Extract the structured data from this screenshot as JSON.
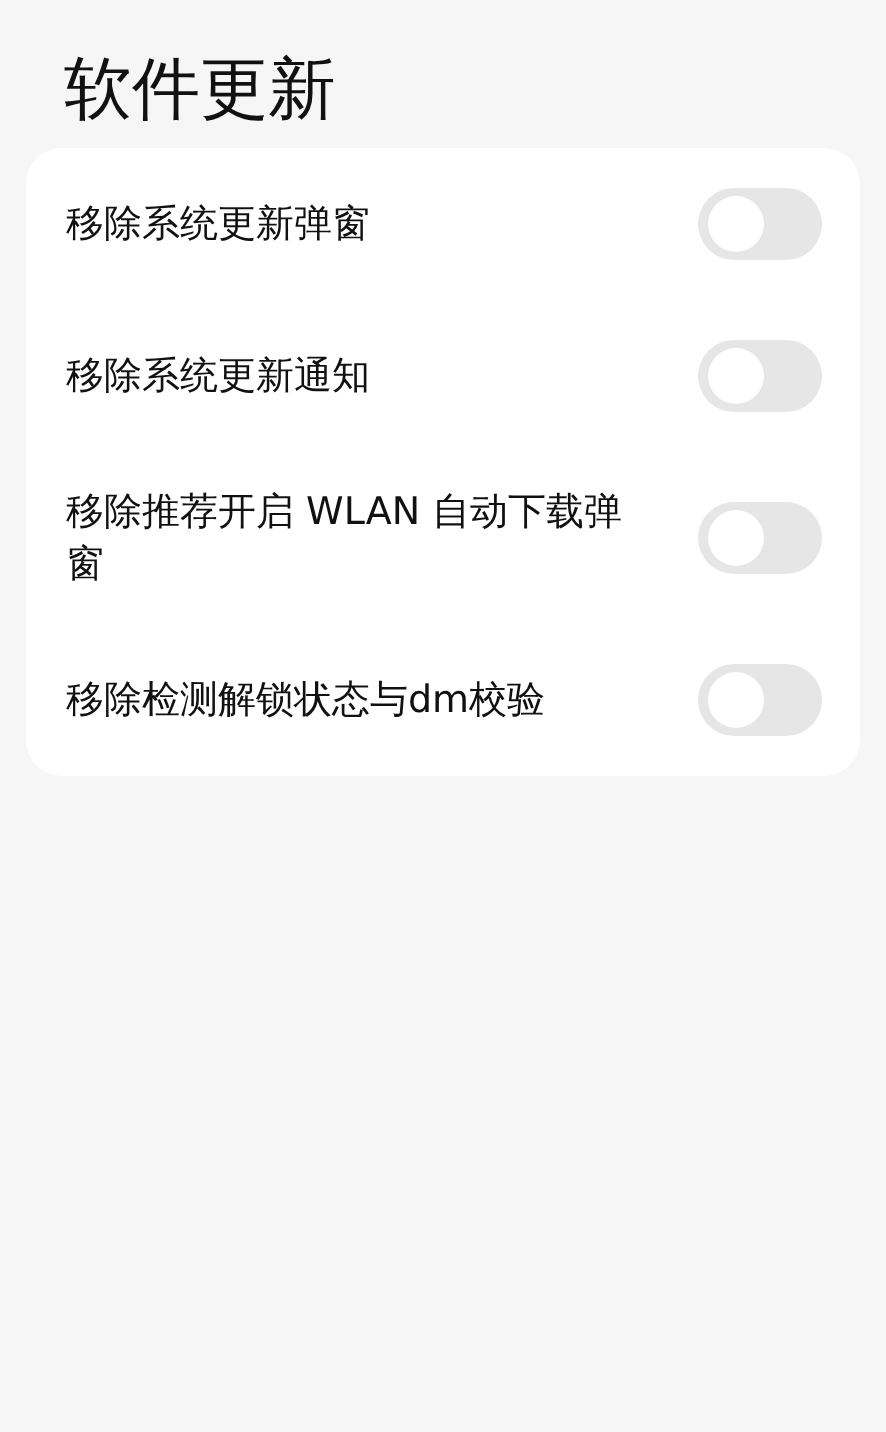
{
  "title": "软件更新",
  "settings": [
    {
      "label": "移除系统更新弹窗",
      "on": false
    },
    {
      "label": "移除系统更新通知",
      "on": false
    },
    {
      "label": "移除推荐开启 WLAN 自动下载弹窗",
      "on": false
    },
    {
      "label": "移除检测解锁状态与dm校验",
      "on": false
    }
  ]
}
